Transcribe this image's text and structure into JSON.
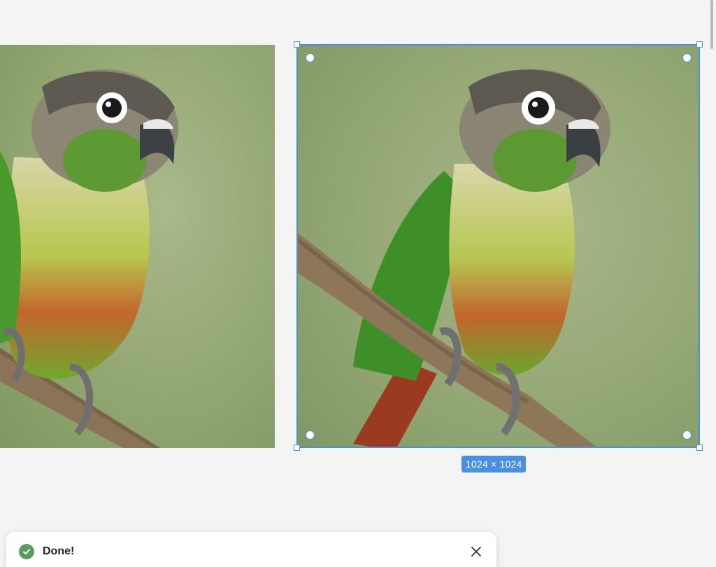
{
  "canvas": {
    "selection": {
      "size_label": "1024 × 1024",
      "accent_color": "#4a90e2"
    },
    "images": [
      {
        "name": "parrot-left",
        "subject": "green-cheeked conure on branch"
      },
      {
        "name": "parrot-right",
        "subject": "green-cheeked conure on branch"
      }
    ]
  },
  "toast": {
    "message": "Done!",
    "status_icon": "check-circle-icon",
    "close_icon": "close-icon",
    "status_color": "#5a9b61"
  }
}
